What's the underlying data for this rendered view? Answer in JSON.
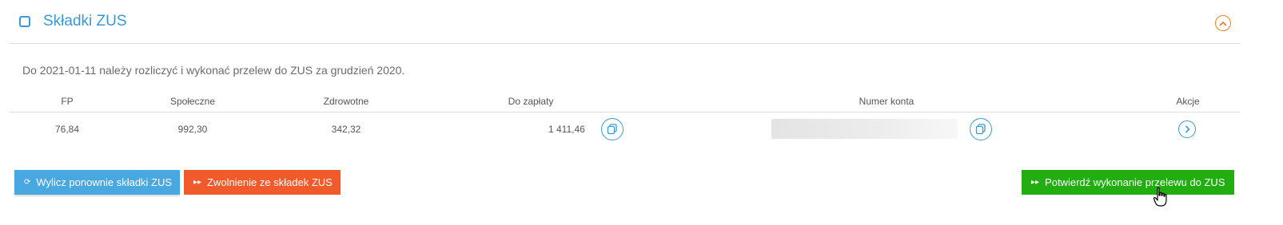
{
  "header": {
    "title": "Składki ZUS"
  },
  "info": {
    "text": "Do 2021-01-11 należy rozliczyć i wykonać przelew do ZUS za grudzień 2020."
  },
  "table": {
    "columns": {
      "fp": "FP",
      "spoleczne": "Społeczne",
      "zdrowotne": "Zdrowotne",
      "do_zaplaty": "Do zapłaty",
      "numer_konta": "Numer konta",
      "akcje": "Akcje"
    },
    "row": {
      "fp": "76,84",
      "spoleczne": "992,30",
      "zdrowotne": "342,32",
      "do_zaplaty": "1 411,46"
    }
  },
  "buttons": {
    "recalc": "Wylicz ponownie składki ZUS",
    "exempt": "Zwolnienie ze składek ZUS",
    "confirm": "Potwierdź wykonanie przelewu do ZUS"
  },
  "colors": {
    "accent": "#3a98d6",
    "collapse": "#f07d1c",
    "recalc": "#49a8e0",
    "exempt": "#f15a2b",
    "confirm": "#22ad11"
  },
  "icons": {
    "checkbox": "checkbox-icon",
    "collapse": "chevron-up-icon",
    "copy": "copy-icon",
    "action": "chevron-right-icon",
    "recalc": "refresh-icon",
    "arrows": "double-arrow-icon"
  }
}
